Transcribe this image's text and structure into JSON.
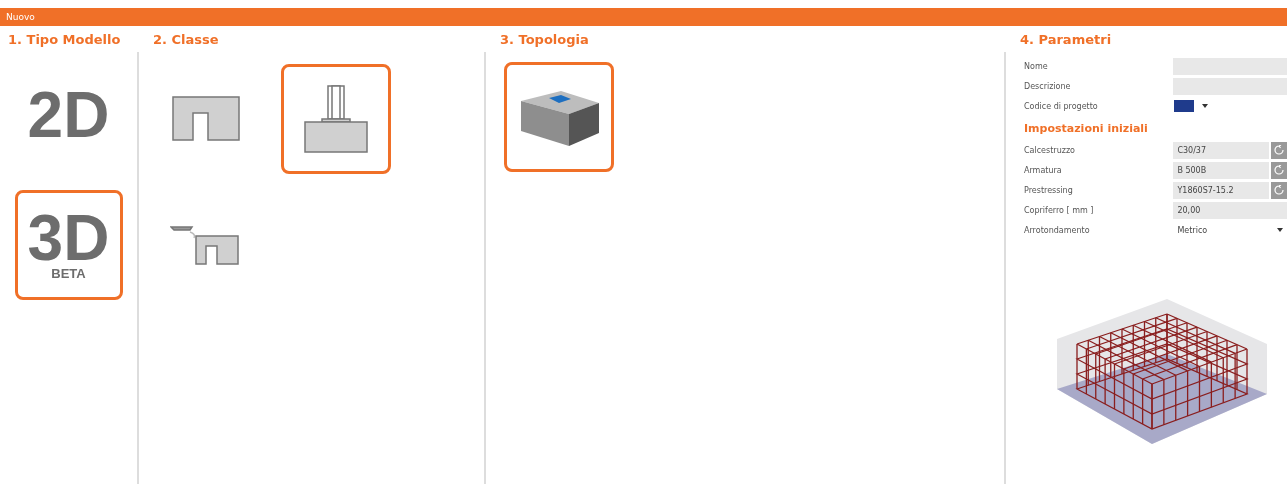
{
  "window": {
    "title": "Nuovo"
  },
  "model_type": {
    "heading": "1. Tipo Modello",
    "options": [
      {
        "label": "2D",
        "selected": false
      },
      {
        "label": "3D",
        "sublabel": "BETA",
        "selected": true
      }
    ]
  },
  "classes": {
    "heading": "2. Classe",
    "options": [
      {
        "kind": "section",
        "selected": false
      },
      {
        "kind": "footing",
        "selected": true
      },
      {
        "kind": "section-detail",
        "selected": false
      }
    ]
  },
  "topology": {
    "heading": "3. Topologia",
    "options": [
      {
        "kind": "block",
        "selected": true
      }
    ]
  },
  "parameters": {
    "heading": "4. Parametri",
    "fields": [
      {
        "label": "Nome",
        "kind": "text"
      },
      {
        "label": "Descrizione",
        "kind": "text"
      },
      {
        "label": "Codice di progetto",
        "kind": "flag"
      }
    ],
    "subheading": "Impostazioni iniziali",
    "settings": [
      {
        "label": "Calcestruzzo",
        "value": "C30/37",
        "kind": "reset"
      },
      {
        "label": "Armatura",
        "value": "B 500B",
        "kind": "reset"
      },
      {
        "label": "Prestressing",
        "value": "Y1860S7-15.2",
        "kind": "reset"
      },
      {
        "label": "Copriferro  [ mm ]",
        "value": "20,00",
        "kind": "text"
      },
      {
        "label": "Arrotondamento",
        "value": "Metrico",
        "kind": "dropdown"
      }
    ]
  }
}
